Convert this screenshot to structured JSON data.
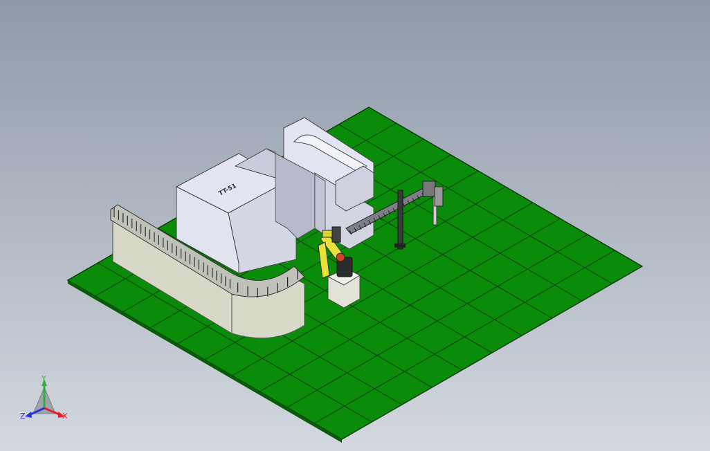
{
  "viewport": {
    "background_top": "#8e99a8",
    "background_bottom": "#d3d8df"
  },
  "scene": {
    "floor_color": "#0a8c0a",
    "grid_color": "#0a3f0a",
    "machine_color": "#e3e6f2",
    "machine_shadow": "#b8bccc",
    "machine_dark": "#9da2b4",
    "conveyor_color": "#d8d8c8",
    "robot_color": "#e7e23a",
    "machine_label": "TT-51"
  },
  "triad": {
    "x_label": "X",
    "y_label": "Y",
    "z_label": "Z",
    "x_color": "#e0202a",
    "y_color": "#2fae3a",
    "z_color": "#2a34d8"
  }
}
